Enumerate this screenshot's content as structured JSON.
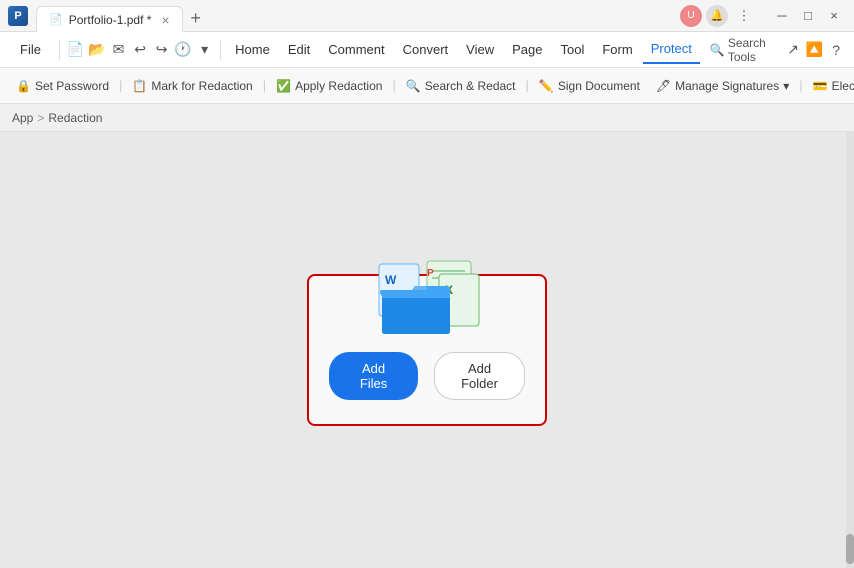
{
  "titlebar": {
    "tab_title": "Portfolio-1.pdf *",
    "close_tab": "×",
    "add_tab": "+",
    "min_btn": "─",
    "max_btn": "□",
    "close_btn": "×",
    "more_icon": "⋮"
  },
  "menubar": {
    "file": "File",
    "home": "Home",
    "edit": "Edit",
    "comment": "Comment",
    "convert": "Convert",
    "view": "View",
    "page": "Page",
    "tool": "Tool",
    "form": "Form",
    "protect": "Protect",
    "search_tools": "Search Tools"
  },
  "toolbar": {
    "set_password": "Set Password",
    "mark_redaction": "Mark for Redaction",
    "apply_redaction": "Apply Redaction",
    "search_redact": "Search & Redact",
    "sign_document": "Sign Document",
    "manage_signatures": "Manage Signatures",
    "electronic": "Electro"
  },
  "breadcrumb": {
    "app": "App",
    "separator": "  ",
    "section": "Redaction"
  },
  "main": {
    "add_files_label": "Add Files",
    "add_folder_label": "Add Folder"
  },
  "colors": {
    "active_tab_text": "#1a73e8",
    "border_red": "#cc0000",
    "btn_primary_bg": "#1a73e8"
  }
}
